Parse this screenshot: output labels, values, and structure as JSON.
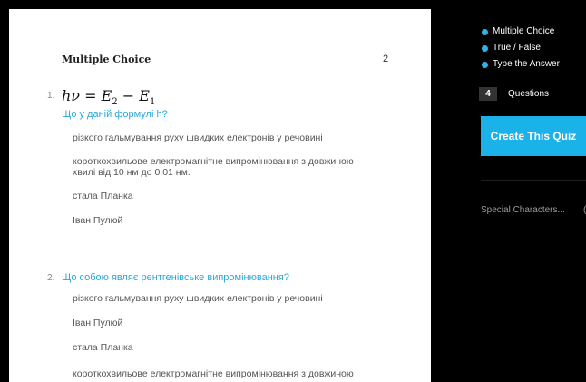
{
  "quiz": {
    "section_title": "Multiple Choice",
    "page_number": "2",
    "questions": [
      {
        "number": "1.",
        "formula": {
          "lhs": "hν",
          "rhs_a": "E",
          "sub_a": "2",
          "rhs_b": "E",
          "sub_b": "1"
        },
        "text": "Що у даній формулі h?",
        "answers": [
          "різкого гальмування руху швидких електронів у речовині",
          "короткохвильове електромагнітне випромінювання з довжиною хвилі від 10 нм до 0.01 нм.",
          "стала Планка",
          "Іван Пулюй"
        ]
      },
      {
        "number": "2.",
        "text": "Що собою являє рентгенівське випромінювання?",
        "answers": [
          "різкого гальмування руху швидких електронів у речовині",
          "Іван Пулюй",
          "стала Планка",
          "короткохвильове електромагнітне випромінювання з довжиною"
        ]
      }
    ]
  },
  "sidebar": {
    "legend": [
      "Multiple Choice",
      "True / False",
      "Type the Answer"
    ],
    "question_count": "4",
    "question_count_label": "Questions",
    "create_button": "Create This Quiz",
    "special_characters": "Special Characters...",
    "special_more": "(",
    "accent_color": "#1ab2e8"
  }
}
